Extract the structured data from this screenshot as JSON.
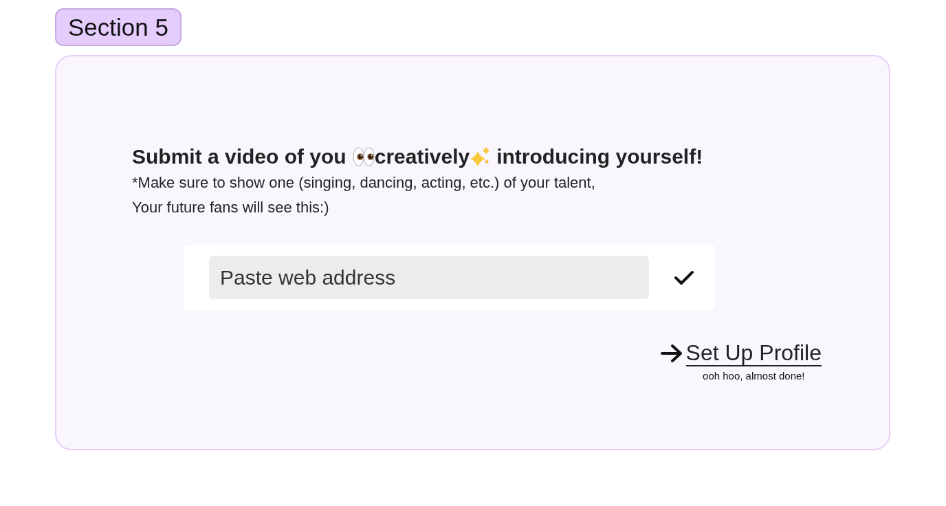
{
  "section_badge": {
    "label": "Section 5"
  },
  "prompt": {
    "heading": {
      "before": "Submit a video of you",
      "middle": "creatively",
      "after": "introducing yourself!"
    },
    "lines": [
      "*Make sure to show one (singing, dancing, acting, etc.) of your talent,",
      "Your future fans will see this:)"
    ]
  },
  "video_link": {
    "placeholder": "Paste web address"
  },
  "next": {
    "link": "Set Up Profile",
    "note": "ooh hoo, almost done!"
  }
}
